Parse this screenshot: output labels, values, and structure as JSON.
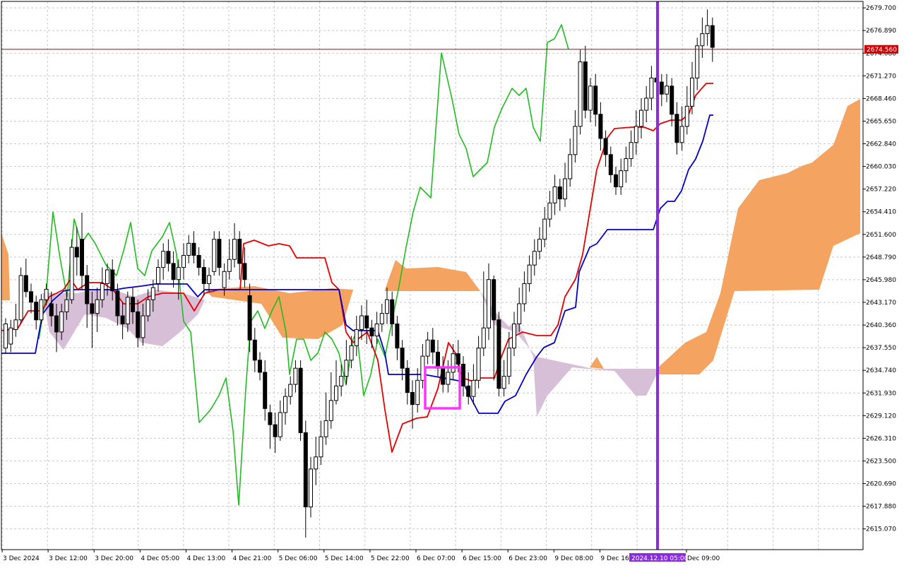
{
  "chart_data": {
    "type": "candlestick",
    "y_axis": {
      "min": 2612.5,
      "max": 2680.5,
      "tick_labels": [
        "2679.700",
        "2676.890",
        "2674.080",
        "2671.270",
        "2668.460",
        "2665.650",
        "2662.840",
        "2660.030",
        "2657.220",
        "2654.410",
        "2651.600",
        "2648.790",
        "2645.980",
        "2643.170",
        "2640.360",
        "2637.550",
        "2634.740",
        "2631.930",
        "2629.120",
        "2626.310",
        "2623.500",
        "2620.690",
        "2617.880",
        "2615.070"
      ]
    },
    "x_axis": {
      "tick_labels": [
        "3 Dec 2024",
        "3 Dec 12:00",
        "3 Dec 20:00",
        "4 Dec 05:00",
        "4 Dec 13:00",
        "4 Dec 21:00",
        "5 Dec 06:00",
        "5 Dec 14:00",
        "5 Dec 22:00",
        "6 Dec 07:00",
        "6 Dec 15:00",
        "6 Dec 23:00",
        "9 Dec 08:00",
        "9 Dec 16:00",
        "Dec 09:00"
      ]
    },
    "current_price": {
      "label": "2674.560",
      "value": 2674.56,
      "color": "#cc0000"
    },
    "vertical_marker": {
      "label": "2024.12.10 05:00",
      "color": "#8a2be2"
    },
    "grid": true,
    "candles": [
      [
        2637.5,
        2640.5,
        2636.8,
        2641.2
      ],
      [
        2638.0,
        2640.0,
        2637.0,
        2641.0
      ],
      [
        2639.8,
        2641.0,
        2638.9,
        2643.0
      ],
      [
        2641.0,
        2646.5,
        2640.5,
        2647.5
      ],
      [
        2646.5,
        2644.5,
        2643.8,
        2648.6
      ],
      [
        2644.5,
        2643.2,
        2641.8,
        2645.5
      ],
      [
        2643.2,
        2641.0,
        2639.8,
        2644.0
      ],
      [
        2641.0,
        2643.5,
        2640.5,
        2644.2
      ],
      [
        2643.5,
        2644.8,
        2642.8,
        2645.5
      ],
      [
        2643.0,
        2641.5,
        2640.2,
        2644.5
      ],
      [
        2641.5,
        2639.5,
        2637.0,
        2643.0
      ],
      [
        2639.5,
        2642.0,
        2638.5,
        2643.0
      ],
      [
        2642.0,
        2643.5,
        2641.0,
        2644.5
      ],
      [
        2643.5,
        2650.0,
        2643.0,
        2651.0
      ],
      [
        2650.0,
        2648.8,
        2646.5,
        2652.5
      ],
      [
        2651.0,
        2646.5,
        2644.8,
        2654.3
      ],
      [
        2646.5,
        2643.0,
        2640.0,
        2647.8
      ],
      [
        2643.0,
        2641.8,
        2637.5,
        2644.5
      ],
      [
        2641.8,
        2643.5,
        2639.5,
        2645.0
      ],
      [
        2643.5,
        2645.5,
        2642.5,
        2647.5
      ],
      [
        2645.5,
        2647.2,
        2644.0,
        2648.0
      ],
      [
        2647.2,
        2644.6,
        2643.4,
        2648.5
      ],
      [
        2644.6,
        2641.5,
        2640.3,
        2645.5
      ],
      [
        2641.5,
        2640.5,
        2638.6,
        2643.2
      ],
      [
        2640.5,
        2643.8,
        2639.5,
        2644.5
      ],
      [
        2643.8,
        2642.0,
        2640.5,
        2645.0
      ],
      [
        2642.0,
        2638.8,
        2637.6,
        2643.5
      ],
      [
        2638.8,
        2641.5,
        2637.8,
        2643.0
      ],
      [
        2641.5,
        2643.5,
        2640.8,
        2644.8
      ],
      [
        2643.5,
        2645.0,
        2642.0,
        2646.0
      ],
      [
        2645.5,
        2647.5,
        2644.5,
        2648.5
      ],
      [
        2647.5,
        2649.5,
        2646.0,
        2650.5
      ],
      [
        2649.5,
        2648.0,
        2647.0,
        2651.0
      ],
      [
        2648.0,
        2646.0,
        2645.0,
        2649.5
      ],
      [
        2646.0,
        2647.5,
        2643.5,
        2648.5
      ],
      [
        2647.5,
        2649.0,
        2646.0,
        2650.5
      ],
      [
        2649.0,
        2650.5,
        2648.0,
        2651.5
      ],
      [
        2650.5,
        2649.0,
        2648.0,
        2652.0
      ],
      [
        2649.0,
        2647.5,
        2646.5,
        2650.0
      ],
      [
        2647.5,
        2645.5,
        2644.0,
        2648.5
      ],
      [
        2645.5,
        2646.5,
        2644.5,
        2647.5
      ],
      [
        2647.0,
        2651.0,
        2646.5,
        2652.0
      ],
      [
        2651.0,
        2647.5,
        2646.5,
        2652.0
      ],
      [
        2645.0,
        2647.0,
        2644.0,
        2648.0
      ],
      [
        2647.0,
        2648.5,
        2646.0,
        2651.0
      ],
      [
        2648.5,
        2651.0,
        2647.5,
        2653.0
      ],
      [
        2651.0,
        2648.0,
        2646.0,
        2652.0
      ],
      [
        2648.0,
        2646.0,
        2645.0,
        2650.0
      ],
      [
        2644.0,
        2638.5,
        2637.0,
        2645.5
      ],
      [
        2638.5,
        2636.0,
        2634.5,
        2640.0
      ],
      [
        2636.0,
        2634.5,
        2633.5,
        2637.0
      ],
      [
        2634.5,
        2630.0,
        2628.5,
        2636.0
      ],
      [
        2629.5,
        2628.0,
        2625.0,
        2630.5
      ],
      [
        2628.0,
        2626.5,
        2624.5,
        2629.5
      ],
      [
        2626.5,
        2629.5,
        2626.0,
        2631.0
      ],
      [
        2629.5,
        2631.5,
        2628.0,
        2632.5
      ],
      [
        2631.5,
        2633.0,
        2630.5,
        2634.0
      ],
      [
        2633.0,
        2635.0,
        2632.0,
        2636.0
      ],
      [
        2635.0,
        2627.0,
        2626.0,
        2636.0
      ],
      [
        2627.0,
        2617.8,
        2614.0,
        2628.5
      ],
      [
        2617.8,
        2622.5,
        2616.5,
        2624.0
      ],
      [
        2622.5,
        2624.0,
        2620.5,
        2626.5
      ],
      [
        2624.0,
        2626.5,
        2623.0,
        2628.5
      ],
      [
        2626.5,
        2628.5,
        2625.5,
        2632.0
      ],
      [
        2628.5,
        2631.0,
        2627.5,
        2634.5
      ],
      [
        2631.0,
        2632.8,
        2630.5,
        2636.0
      ],
      [
        2632.8,
        2634.0,
        2631.5,
        2635.5
      ],
      [
        2634.0,
        2636.0,
        2633.0,
        2638.5
      ],
      [
        2636.0,
        2637.8,
        2635.0,
        2639.0
      ],
      [
        2637.8,
        2639.8,
        2636.5,
        2641.5
      ],
      [
        2639.8,
        2641.5,
        2638.5,
        2642.8
      ],
      [
        2641.5,
        2640.0,
        2638.0,
        2643.5
      ],
      [
        2640.0,
        2639.0,
        2637.5,
        2641.0
      ],
      [
        2639.0,
        2640.5,
        2638.0,
        2642.0
      ],
      [
        2640.5,
        2641.8,
        2639.5,
        2643.0
      ],
      [
        2641.8,
        2643.5,
        2640.5,
        2645.0
      ],
      [
        2643.5,
        2640.5,
        2639.0,
        2644.5
      ],
      [
        2640.5,
        2637.5,
        2636.0,
        2641.5
      ],
      [
        2637.5,
        2635.0,
        2633.5,
        2638.5
      ],
      [
        2635.0,
        2632.0,
        2630.5,
        2636.0
      ],
      [
        2632.0,
        2630.5,
        2627.5,
        2633.5
      ],
      [
        2630.5,
        2633.5,
        2629.5,
        2635.0
      ],
      [
        2633.5,
        2636.5,
        2632.5,
        2638.0
      ],
      [
        2636.5,
        2638.5,
        2635.5,
        2639.5
      ],
      [
        2638.5,
        2637.0,
        2635.5,
        2640.0
      ],
      [
        2637.0,
        2635.0,
        2634.0,
        2638.5
      ],
      [
        2635.0,
        2633.0,
        2632.0,
        2636.5
      ],
      [
        2633.0,
        2634.5,
        2632.0,
        2636.0
      ],
      [
        2634.5,
        2636.8,
        2633.5,
        2638.0
      ],
      [
        2636.8,
        2635.5,
        2634.5,
        2638.5
      ],
      [
        2635.5,
        2632.8,
        2631.5,
        2636.5
      ],
      [
        2632.8,
        2631.5,
        2630.5,
        2634.5
      ],
      [
        2631.5,
        2633.5,
        2630.5,
        2635.5
      ],
      [
        2633.5,
        2637.5,
        2632.5,
        2639.0
      ],
      [
        2637.5,
        2640.0,
        2636.5,
        2647.0
      ],
      [
        2640.0,
        2646.0,
        2638.5,
        2648.0
      ],
      [
        2646.0,
        2641.0,
        2633.5,
        2646.5
      ],
      [
        2641.0,
        2632.5,
        2631.5,
        2642.0
      ],
      [
        2632.5,
        2634.0,
        2631.5,
        2636.0
      ],
      [
        2634.0,
        2637.5,
        2633.0,
        2639.5
      ],
      [
        2637.5,
        2640.5,
        2636.5,
        2642.0
      ],
      [
        2640.5,
        2643.0,
        2639.5,
        2645.0
      ],
      [
        2643.0,
        2645.5,
        2642.0,
        2647.0
      ],
      [
        2645.5,
        2647.8,
        2644.5,
        2649.0
      ],
      [
        2647.8,
        2649.5,
        2646.5,
        2651.0
      ],
      [
        2649.5,
        2651.0,
        2648.5,
        2652.5
      ],
      [
        2651.0,
        2653.5,
        2650.0,
        2655.0
      ],
      [
        2653.5,
        2655.5,
        2652.5,
        2657.0
      ],
      [
        2655.5,
        2657.5,
        2654.0,
        2659.0
      ],
      [
        2657.5,
        2656.0,
        2654.5,
        2658.5
      ],
      [
        2656.0,
        2658.5,
        2655.0,
        2660.5
      ],
      [
        2658.5,
        2661.5,
        2657.5,
        2663.5
      ],
      [
        2661.5,
        2665.0,
        2660.5,
        2667.0
      ],
      [
        2665.0,
        2673.0,
        2664.0,
        2674.5
      ],
      [
        2673.0,
        2667.0,
        2666.0,
        2675.0
      ],
      [
        2667.0,
        2670.0,
        2665.5,
        2671.0
      ],
      [
        2670.0,
        2666.5,
        2665.0,
        2671.5
      ],
      [
        2666.5,
        2663.5,
        2662.0,
        2668.0
      ],
      [
        2663.5,
        2661.5,
        2660.0,
        2664.5
      ],
      [
        2661.5,
        2659.0,
        2658.0,
        2662.5
      ],
      [
        2659.0,
        2657.5,
        2656.5,
        2660.0
      ],
      [
        2657.5,
        2659.5,
        2656.5,
        2661.0
      ],
      [
        2659.5,
        2661.0,
        2658.0,
        2662.5
      ],
      [
        2661.0,
        2663.0,
        2660.0,
        2664.5
      ],
      [
        2663.0,
        2665.0,
        2661.5,
        2667.0
      ],
      [
        2665.0,
        2667.0,
        2663.5,
        2668.5
      ],
      [
        2667.0,
        2668.5,
        2665.5,
        2670.0
      ],
      [
        2668.5,
        2671.0,
        2667.0,
        2672.5
      ],
      [
        2671.0,
        2670.5,
        2669.5,
        2672.5
      ],
      [
        2670.5,
        2669.0,
        2667.5,
        2671.5
      ],
      [
        2669.0,
        2670.0,
        2668.0,
        2671.5
      ],
      [
        2670.0,
        2666.5,
        2665.0,
        2671.0
      ],
      [
        2666.5,
        2663.0,
        2661.5,
        2668.0
      ],
      [
        2663.0,
        2665.0,
        2662.0,
        2667.5
      ],
      [
        2665.0,
        2667.5,
        2664.0,
        2670.0
      ],
      [
        2667.5,
        2671.0,
        2666.5,
        2673.0
      ],
      [
        2671.0,
        2675.0,
        2669.5,
        2676.0
      ],
      [
        2675.0,
        2676.5,
        2673.5,
        2678.5
      ],
      [
        2676.5,
        2677.5,
        2675.0,
        2679.5
      ],
      [
        2677.5,
        2674.8,
        2673.0,
        2678.5
      ]
    ],
    "tenkan_sen": {
      "color": "#e60000"
    },
    "kijun_sen": {
      "color": "#0000cc"
    },
    "chikou_span": {
      "color": "#22bb22"
    },
    "cloud_bull_color": "#f4a460",
    "cloud_bear_color": "#d8bfd8"
  }
}
